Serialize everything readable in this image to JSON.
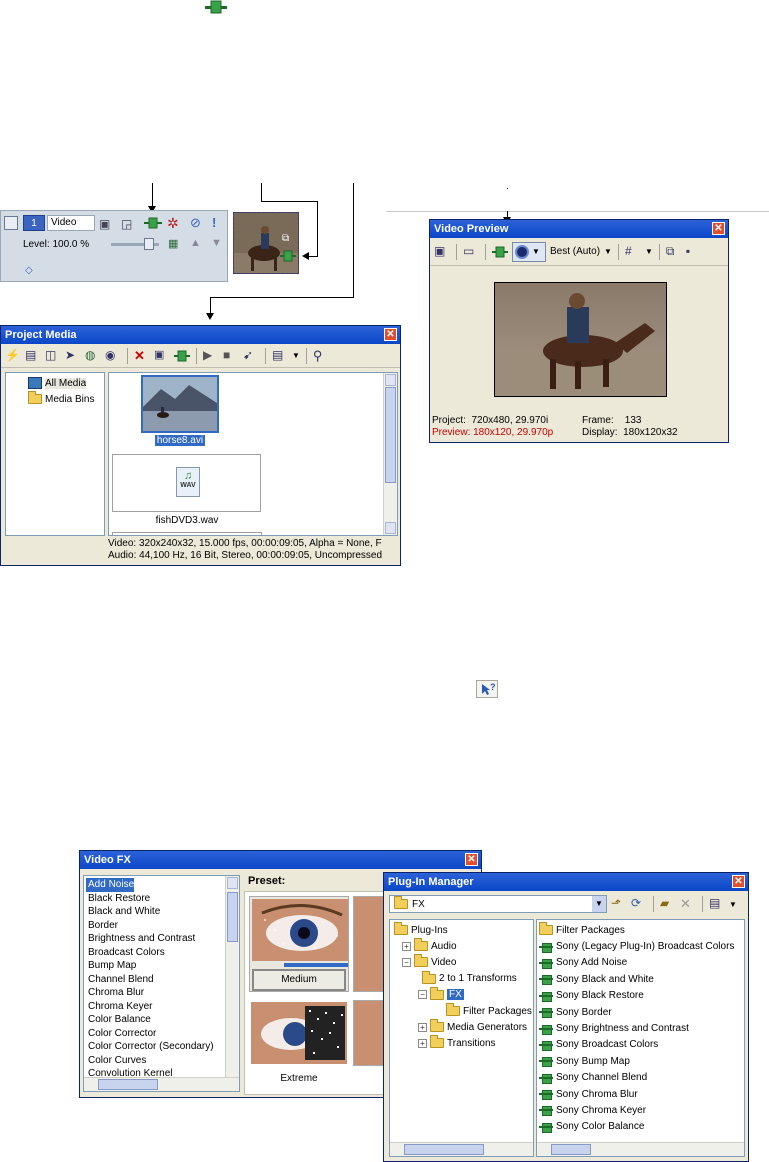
{
  "track_header": {
    "track_number": "1",
    "track_name": "Video",
    "level": "Level: 100.0 %"
  },
  "project_media": {
    "title": "Project Media",
    "tree": [
      "All Media",
      "Media Bins"
    ],
    "items": [
      {
        "name": "horse8.avi"
      },
      {
        "name": "fishDVD3.wav",
        "badge": "WAV"
      }
    ],
    "status_video": "Video: 320x240x32, 15.000 fps, 00:00:09:05, Alpha = None, F",
    "status_audio": "Audio: 44,100 Hz, 16 Bit, Stereo, 00:00:09:05, Uncompressed"
  },
  "video_preview": {
    "title": "Video Preview",
    "quality": "Best (Auto)",
    "project": "Project:  720x480, 29.970i",
    "frame": "Frame:    133",
    "preview": "Preview: 180x120, 29.970p",
    "display": "Display:  180x120x32",
    "preview_color": "#cc0000"
  },
  "video_fx": {
    "title": "Video FX",
    "preset_label": "Preset:",
    "list": [
      "Add Noise",
      "Black Restore",
      "Black and White",
      "Border",
      "Brightness and Contrast",
      "Broadcast Colors",
      "Bump Map",
      "Channel Blend",
      "Chroma Blur",
      "Chroma Keyer",
      "Color Balance",
      "Color Corrector",
      "Color Corrector (Secondary)",
      "Color Curves",
      "Convolution Kernel"
    ],
    "presets": [
      "Medium",
      "Extreme"
    ]
  },
  "plugin_manager": {
    "title": "Plug-In Manager",
    "path": "FX",
    "tree": [
      {
        "label": "Plug-Ins",
        "expander": ""
      },
      {
        "label": "Audio",
        "expander": "+"
      },
      {
        "label": "Video",
        "expander": "−"
      },
      {
        "label": "2 to 1 Transforms",
        "expander": ""
      },
      {
        "label": "FX",
        "expander": "−"
      },
      {
        "label": "Filter Packages",
        "expander": ""
      },
      {
        "label": "Media Generators",
        "expander": "+"
      },
      {
        "label": "Transitions",
        "expander": "+"
      }
    ],
    "list": [
      "Filter Packages",
      "Sony (Legacy Plug-In) Broadcast Colors",
      "Sony Add Noise",
      "Sony Black and White",
      "Sony Black Restore",
      "Sony Border",
      "Sony Brightness and Contrast",
      "Sony Broadcast Colors",
      "Sony Bump Map",
      "Sony Channel Blend",
      "Sony Chroma Blur",
      "Sony Chroma Keyer",
      "Sony Color Balance"
    ]
  },
  "colors": {
    "titlebar": "#0a47c8",
    "selection": "#316ac5",
    "plugin_green": "#3aa04a"
  }
}
